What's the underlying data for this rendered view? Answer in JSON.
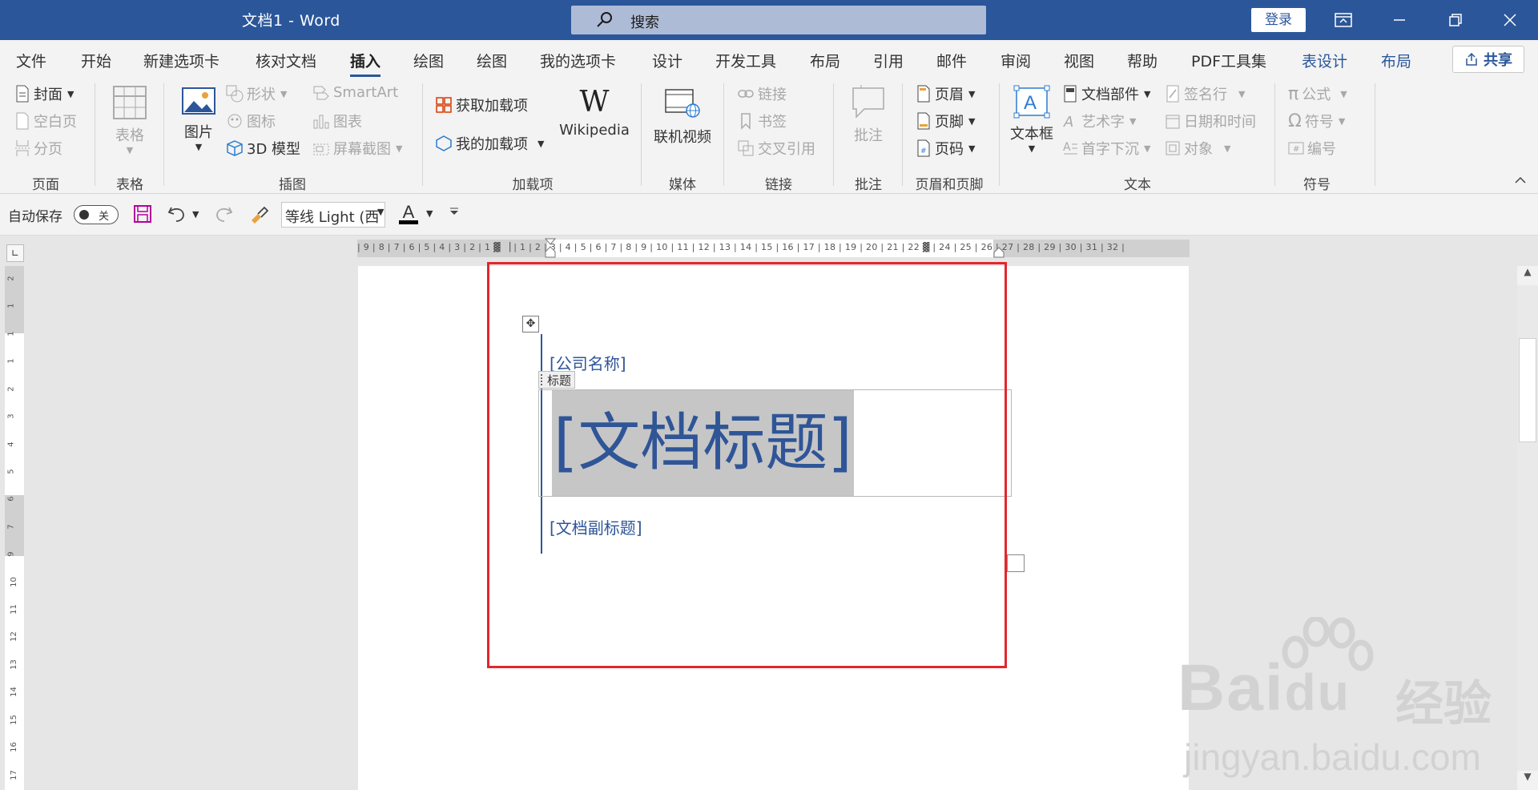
{
  "window": {
    "title": "文档1  -  Word",
    "search_placeholder": "搜索",
    "login_label": "登录"
  },
  "ribbon_tabs": [
    "文件",
    "开始",
    "新建选项卡",
    "核对文档",
    "插入",
    "绘图",
    "绘图",
    "我的选项卡",
    "设计",
    "开发工具",
    "布局",
    "引用",
    "邮件",
    "审阅",
    "视图",
    "帮助",
    "PDF工具集",
    "表设计",
    "布局"
  ],
  "active_tab": "插入",
  "share_label": "共享",
  "ribbon": {
    "page": {
      "cover": "封面",
      "blank": "空白页",
      "break": "分页",
      "label": "页面"
    },
    "table": {
      "table": "表格",
      "label": "表格"
    },
    "illus": {
      "picture": "图片",
      "shapes": "形状",
      "icons": "图标",
      "model3d": "3D 模型",
      "smartart": "SmartArt",
      "chart": "图表",
      "screenshot": "屏幕截图",
      "label": "插图"
    },
    "addins": {
      "get": "获取加载项",
      "my": "我的加载项",
      "wiki": "Wikipedia",
      "label": "加载项"
    },
    "media": {
      "video": "联机视频",
      "label": "媒体"
    },
    "links": {
      "link": "链接",
      "bookmark": "书签",
      "xref": "交叉引用",
      "label": "链接"
    },
    "comments": {
      "comment": "批注",
      "label": "批注"
    },
    "hf": {
      "header": "页眉",
      "footer": "页脚",
      "pagenum": "页码",
      "label": "页眉和页脚"
    },
    "text": {
      "textbox": "文本框",
      "parts": "文档部件",
      "wordart": "艺术字",
      "dropcap": "首字下沉",
      "sigline": "签名行",
      "datetime": "日期和时间",
      "object": "对象",
      "label": "文本"
    },
    "symbols": {
      "equation": "公式",
      "symbol": "符号",
      "number": "编号",
      "label": "符号"
    }
  },
  "qat": {
    "autosave_label": "自动保存",
    "toggle_state": "关",
    "font_name": "等线 Light (西",
    "font_color_glyph": "A"
  },
  "ruler": {
    "horizontal": "| 9 | 8 | 7 | 6 | 5 | 4 | 3 | 2 | 1 ▓ ▕ | 1 | 2 | 3 | 4 | 5 | 6 | 7 | 8 | 9 | 10 | 11 | 12 | 13 | 14 | 15 | 16 | 17 | 18 | 19 | 20 | 21 | 22 ▓ | 24 | 25 | 26 | 27 | 28 | 29 | 30 | 31 | 32 |",
    "vertical": [
      "2",
      "1",
      "1",
      "1",
      "2",
      "3",
      "4",
      "5",
      "6",
      "7",
      "9",
      "10",
      "11",
      "12",
      "13",
      "14",
      "15",
      "16",
      "17"
    ]
  },
  "document": {
    "company": "[公司名称]",
    "title_tag": "标题",
    "title": "[文档标题]",
    "subtitle": "[文档副标题]"
  },
  "watermark": {
    "brand": "Bai",
    "brand2": "du",
    "jingyan": "经验",
    "url": "jingyan.baidu.com"
  },
  "colors": {
    "title_bar": "#2b579a",
    "accent": "#2f5597",
    "highlight_frame": "#e3262c",
    "selection": "#c6c6c6"
  }
}
